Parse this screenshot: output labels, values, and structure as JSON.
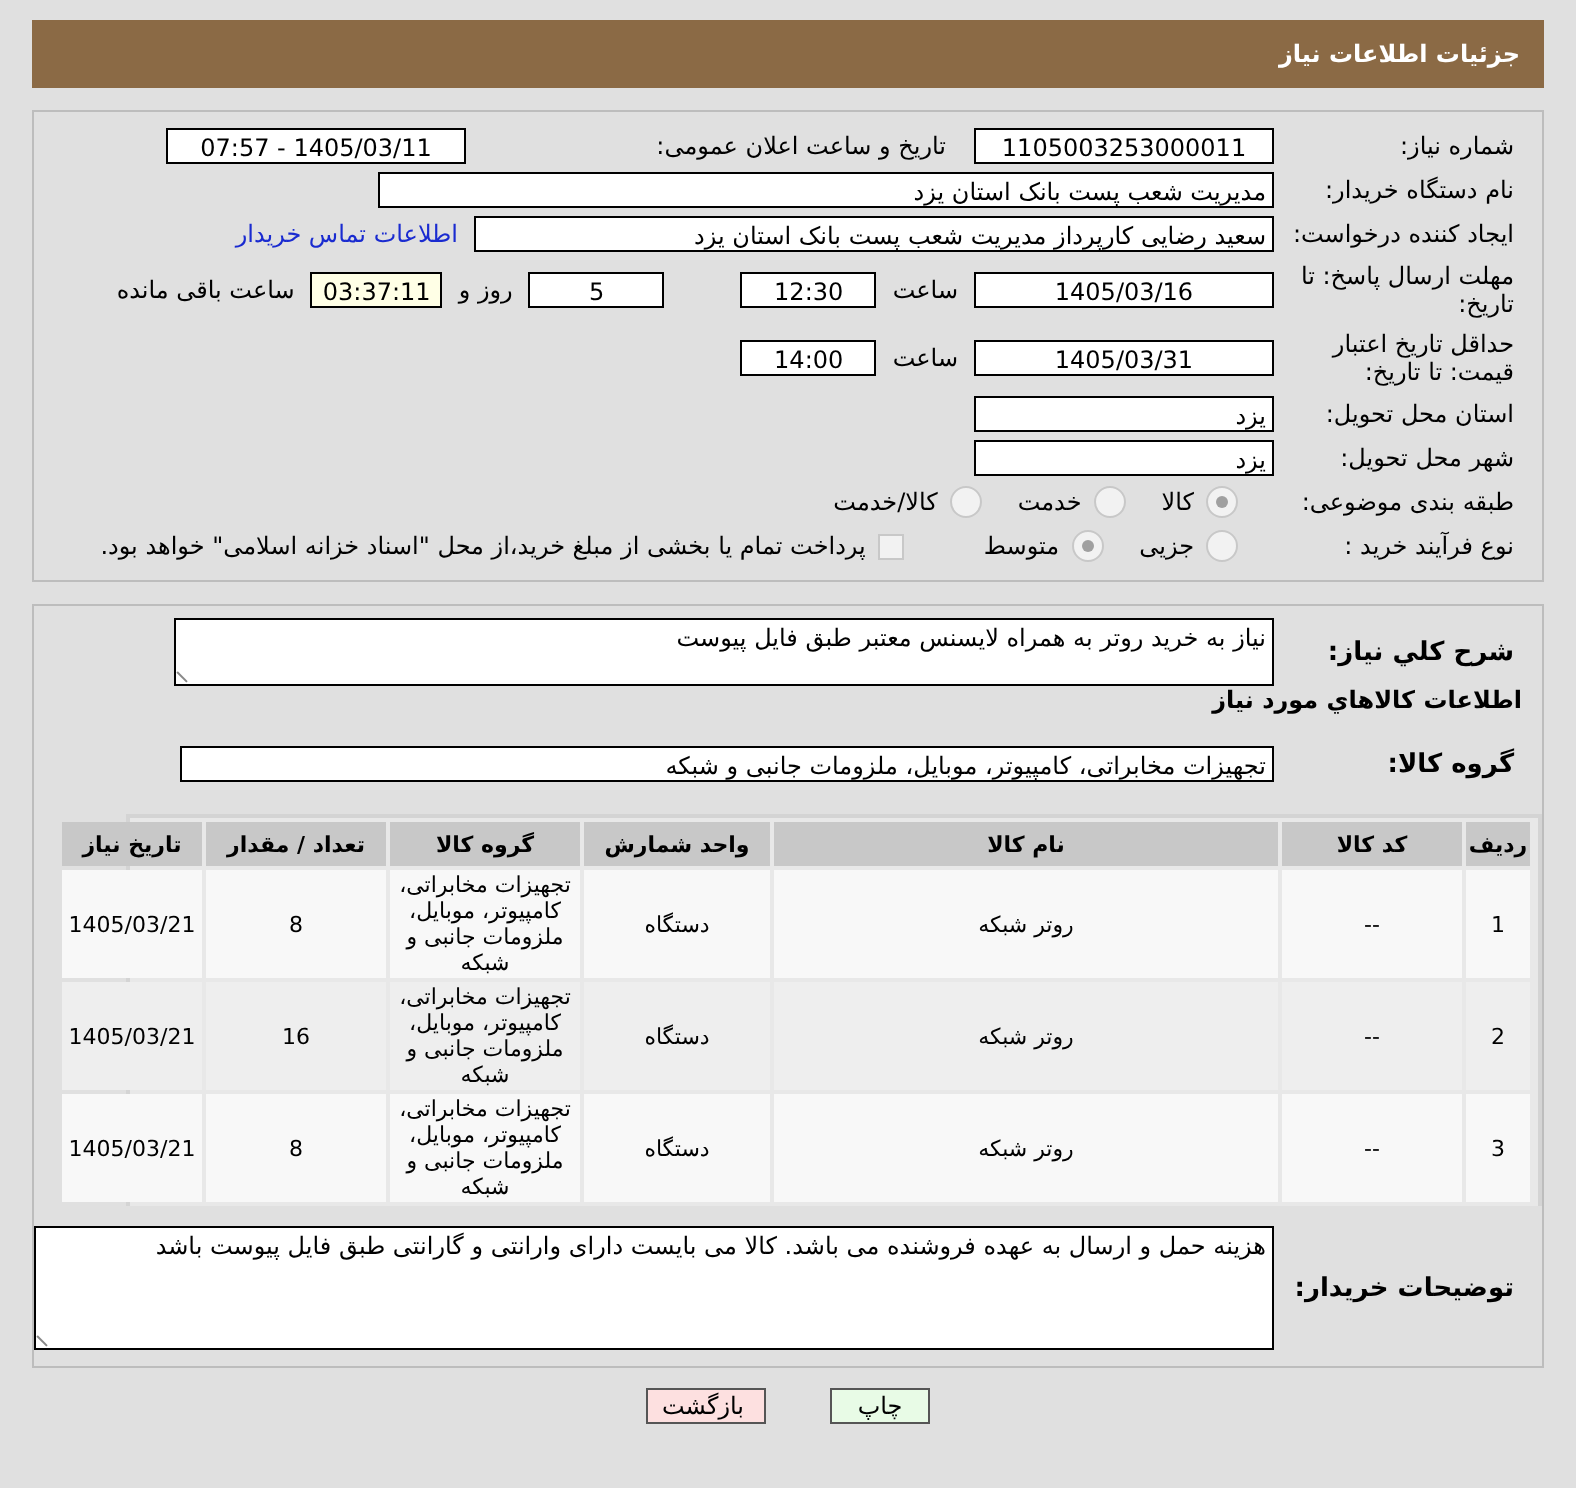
{
  "header": {
    "title": "جزئیات اطلاعات نیاز"
  },
  "need_number": {
    "label": "شماره نیاز:",
    "value": "1105003253000011"
  },
  "announce": {
    "label": "تاریخ و ساعت اعلان عمومی:",
    "value": "1405/03/11 - 07:57"
  },
  "buyer_org": {
    "label": "نام دستگاه خریدار:",
    "value": "مدیریت شعب پست بانک استان یزد"
  },
  "requester": {
    "label": "ایجاد کننده درخواست:",
    "value": "سعید  رضایی کارپرداز مدیریت شعب پست بانک استان یزد",
    "link": "اطلاعات تماس خریدار"
  },
  "reply_deadline": {
    "label": "مهلت ارسال پاسخ: تا تاریخ:",
    "date": "1405/03/16",
    "time_label": "ساعت",
    "time": "12:30",
    "days": "5",
    "days_label": "روز و",
    "remaining": "03:37:11",
    "remaining_label": "ساعت باقی مانده"
  },
  "price_validity": {
    "label": "حداقل تاریخ اعتبار قیمت: تا تاریخ:",
    "date": "1405/03/31",
    "time_label": "ساعت",
    "time": "14:00"
  },
  "province": {
    "label": "استان محل تحویل:",
    "value": "یزد"
  },
  "city": {
    "label": "شهر محل تحویل:",
    "value": "یزد"
  },
  "category": {
    "label": "طبقه بندی موضوعی:",
    "options": [
      {
        "label": "کالا",
        "selected": true
      },
      {
        "label": "خدمت",
        "selected": false
      },
      {
        "label": "کالا/خدمت",
        "selected": false
      }
    ]
  },
  "process": {
    "label": "نوع فرآیند خرید :",
    "options": [
      {
        "label": "جزیی",
        "selected": false
      },
      {
        "label": "متوسط",
        "selected": true
      }
    ],
    "payment": {
      "checked": false,
      "text": "پرداخت تمام یا بخشی از مبلغ خرید،از محل \"اسناد خزانه اسلامی\" خواهد بود."
    }
  },
  "description": {
    "label": "شرح کلي نیاز:",
    "value": "نیاز به خرید روتر به همراه لایسنس معتبر طبق فایل پیوست"
  },
  "goods_heading": "اطلاعات کالاهاي مورد نیاز",
  "goods_group": {
    "label": "گروه کالا:",
    "value": "تجهیزات مخابراتی، کامپیوتر، موبایل، ملزومات جانبی و شبکه"
  },
  "table": {
    "columns": [
      "ردیف",
      "کد کالا",
      "نام کالا",
      "واحد شمارش",
      "گروه کالا",
      "تعداد / مقدار",
      "تاریخ نیاز"
    ],
    "rows": [
      [
        "1",
        "--",
        "روتر شبکه",
        "دستگاه",
        "تجهیزات مخابراتی، کامپیوتر، موبایل، ملزومات جانبی و شبکه",
        "8",
        "1405/03/21"
      ],
      [
        "2",
        "--",
        "روتر شبکه",
        "دستگاه",
        "تجهیزات مخابراتی، کامپیوتر، موبایل، ملزومات جانبی و شبکه",
        "16",
        "1405/03/21"
      ],
      [
        "3",
        "--",
        "روتر شبکه",
        "دستگاه",
        "تجهیزات مخابراتی، کامپیوتر، موبایل، ملزومات جانبی و شبکه",
        "8",
        "1405/03/21"
      ]
    ]
  },
  "buyer_notes": {
    "label": "توضیحات خریدار:",
    "value": "هزینه حمل و ارسال به عهده فروشنده می باشد. کالا می بایست دارای وارانتی و گارانتی طبق فایل پیوست باشد"
  },
  "buttons": [
    {
      "label": "چاپ",
      "kind": "print"
    },
    {
      "label": "بازگشت",
      "kind": "back"
    }
  ]
}
